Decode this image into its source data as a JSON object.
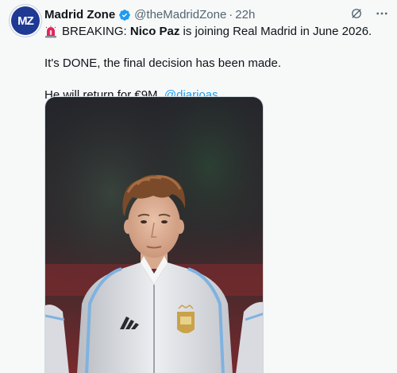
{
  "tweet": {
    "author_name": "Madrid Zone",
    "author_handle": "@theMadridZone",
    "separator": "·",
    "time": "22h",
    "avatar_text": "MZ",
    "line1_prefix": "BREAKING: ",
    "line1_bold": "Nico Paz",
    "line1_suffix": " is joining Real Madrid in June 2026.",
    "paragraph2": "It's DONE, the final decision has been made.",
    "paragraph3_text": "He will return for €9M. ",
    "paragraph3_mention": "@diarioas"
  },
  "icons": {
    "verified": "verified-badge-icon",
    "siren": "siren-emoji-icon",
    "grok": "grok-icon",
    "more": "more-options-icon"
  },
  "colors": {
    "accent": "#1d9bf0",
    "text": "#0f1419",
    "muted": "#536471",
    "background": "#f7f9f9",
    "avatar": "#1f3a93"
  }
}
